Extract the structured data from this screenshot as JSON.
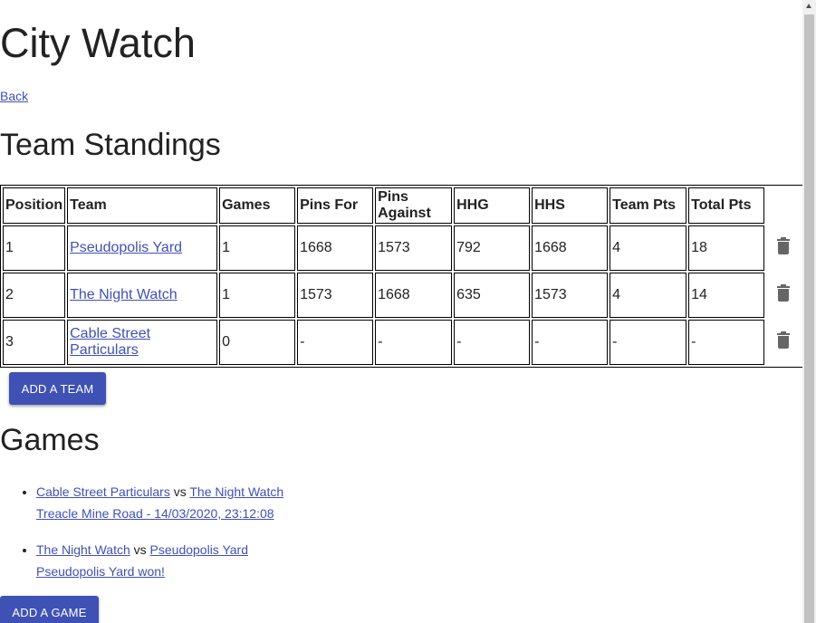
{
  "title": "City Watch",
  "back_link": "Back",
  "standings": {
    "heading": "Team Standings",
    "columns": [
      "Position",
      "Team",
      "Games",
      "Pins For",
      "Pins Against",
      "HHG",
      "HHS",
      "Team Pts",
      "Total Pts"
    ],
    "rows": [
      {
        "position": "1",
        "team": "Pseudopolis Yard",
        "games": "1",
        "pins_for": "1668",
        "pins_against": "1573",
        "hhg": "792",
        "hhs": "1668",
        "team_pts": "4",
        "total_pts": "18"
      },
      {
        "position": "2",
        "team": "The Night Watch",
        "games": "1",
        "pins_for": "1573",
        "pins_against": "1668",
        "hhg": "635",
        "hhs": "1573",
        "team_pts": "4",
        "total_pts": "14"
      },
      {
        "position": "3",
        "team": "Cable Street Particulars",
        "games": "0",
        "pins_for": "-",
        "pins_against": "-",
        "hhg": "-",
        "hhs": "-",
        "team_pts": "-",
        "total_pts": "-"
      }
    ],
    "delete_icon": "trash-icon"
  },
  "add_team_label": "ADD A TEAM",
  "games": {
    "heading": "Games",
    "vs_label": "vs",
    "items": [
      {
        "home": "Cable Street Particulars",
        "away": "The Night Watch",
        "detail": "Treacle Mine Road - 14/03/2020, 23:12:08"
      },
      {
        "home": "The Night Watch",
        "away": "Pseudopolis Yard",
        "detail": "Pseudopolis Yard won!"
      }
    ]
  },
  "add_game_label": "ADD A GAME",
  "colors": {
    "accent": "#3f51b5",
    "text": "#222222",
    "icon": "#666666"
  }
}
